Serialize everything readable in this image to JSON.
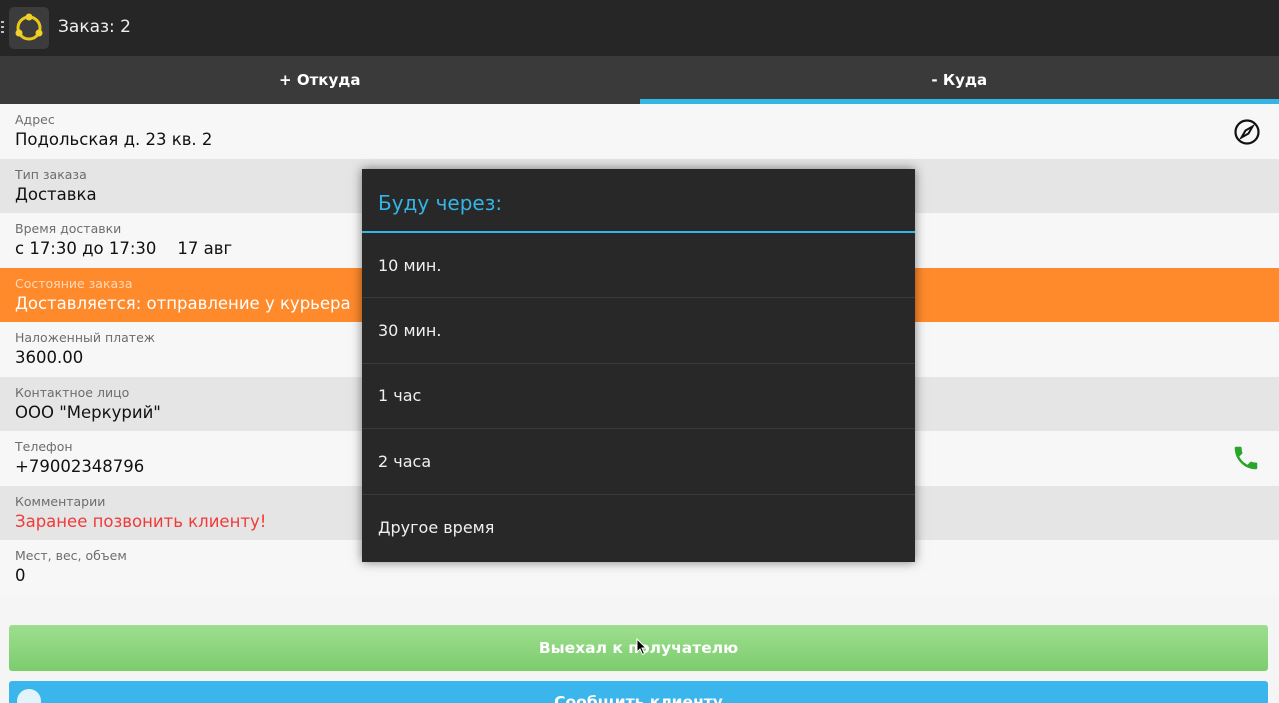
{
  "actionbar": {
    "title": "Заказ: 2"
  },
  "tabs": [
    {
      "label": "+ Откуда",
      "active": false
    },
    {
      "label": "- Куда",
      "active": true
    }
  ],
  "fields": [
    {
      "label": "Адрес",
      "value": "Подольская д. 23 кв. 2",
      "icon": "compass-icon"
    },
    {
      "label": "Тип заказа",
      "value": "Доставка"
    },
    {
      "label": "Время доставки",
      "value": "с 17:30 до 17:30    17 авг"
    },
    {
      "label": "Состояние заказа",
      "value": "Доставляется: отправление у курьера"
    },
    {
      "label": "Наложенный платеж",
      "value": "3600.00"
    },
    {
      "label": "Контактное лицо",
      "value": "ООО \"Меркурий\""
    },
    {
      "label": "Телефон",
      "value": "+79002348796",
      "icon": "phone-icon"
    },
    {
      "label": "Комментарии",
      "value": "Заранее позвонить клиенту!"
    },
    {
      "label": "Мест, вес, объем",
      "value": "0"
    }
  ],
  "buttons": {
    "departed": "Выехал к получателю",
    "inform": "Сообщить клиенту"
  },
  "dialog": {
    "title": "Буду через:",
    "options": [
      "10 мин.",
      "30 мин.",
      "1 час",
      "2 часа",
      "Другое время"
    ]
  },
  "colors": {
    "accent": "#33b5e5",
    "status_orange": "#ff8a2c",
    "green_button": "#7ccd6e",
    "blue_button": "#3bb6ec",
    "comment_red": "#f03a3a",
    "phone_green": "#2aa52a"
  }
}
